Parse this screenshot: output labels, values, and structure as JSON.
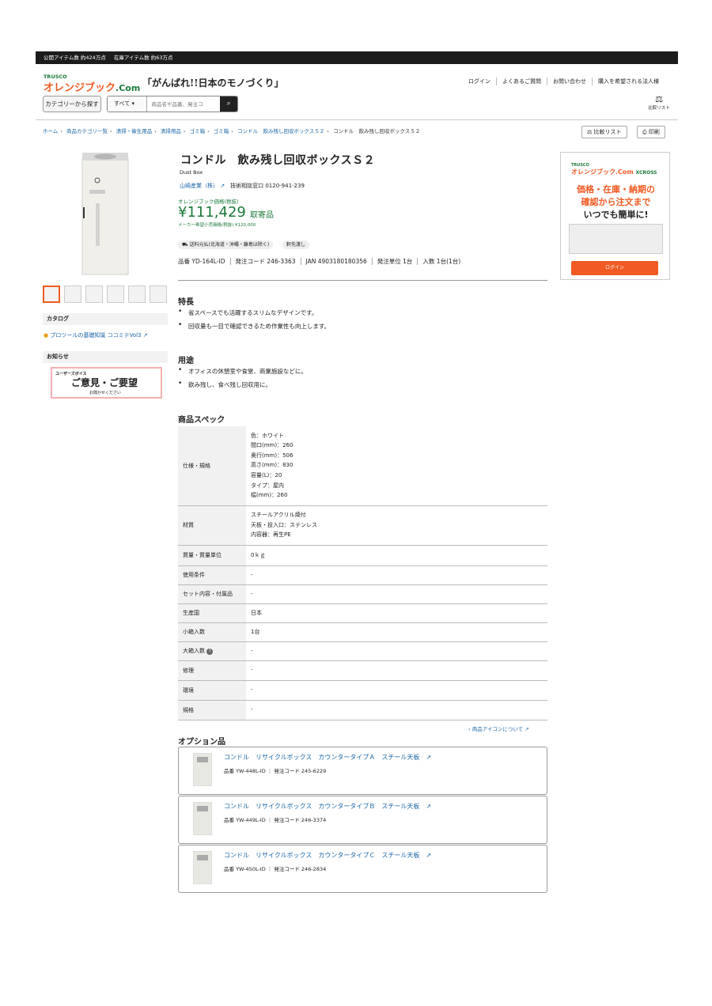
{
  "topbar": {
    "items": "公開アイテム数 約424万点",
    "stock": "在庫アイテム数 約63万点"
  },
  "logo": {
    "brand": "TRUSCO",
    "name": "オレンジブック",
    "suffix": ".Com",
    "slogan": "「がんばれ!!日本のモノづくり」"
  },
  "header_links": [
    "ログイン",
    "よくあるご質問",
    "お問い合わせ",
    "購入を希望される法人様"
  ],
  "search": {
    "category_button": "カテゴリーから探す",
    "scope": "すべて",
    "placeholder": "商品名や品番、発注コ",
    "compare_label": "比較リスト"
  },
  "breadcrumb": [
    "ホーム",
    "商品カテゴリ一覧",
    "清掃・衛生用品",
    "清掃用品",
    "ゴミ箱",
    "ゴミ箱",
    "コンドル　飲み残し回収ボックスＳ２",
    "コンドル　飲み残し回収ボックスＳ２"
  ],
  "actions": {
    "compare": "比較リスト",
    "print": "印刷"
  },
  "product": {
    "title": "コンドル　飲み残し回収ボックスＳ２",
    "subtitle": "Dust Box",
    "maker": "山崎産業（株）",
    "support": "技術相談窓口 0120-941-239",
    "price_label": "オレンジブック価格(税抜)",
    "price": "¥111,429",
    "order_type": "取寄品",
    "list_price": "メーカー希望小売価格(税抜) ¥120,000",
    "tags": [
      "送料元払(北海道・沖縄・離島は除く)",
      "軒先渡し"
    ],
    "meta": [
      "品番 YD-164L-ID",
      "発注コード 246-3363",
      "JAN 4903180180356",
      "発注単位 1台",
      "入数 1台(1台)"
    ]
  },
  "sidebar": {
    "catalog_title": "カタログ",
    "catalog_link": "プロツールの基礎知識 ココミテVol3",
    "news_title": "お知らせ",
    "voice_banner": "ご意見・ご要望",
    "voice_sub": "お聞かせください",
    "voice_label": "ユーザーズボイス"
  },
  "features": {
    "title": "特長",
    "items": [
      "省スペースでも活躍するスリムなデザインです。",
      "回収量も一目で確認できるため作業性も向上します。"
    ]
  },
  "uses": {
    "title": "用途",
    "items": [
      "オフィスの休憩室や食堂、商業施設などに。",
      "飲み残し、食べ残し回収用に。"
    ]
  },
  "spec": {
    "title": "商品スペック",
    "rows": [
      {
        "k": "仕様・規格",
        "v": [
          "色：ホワイト",
          "間口(mm)：260",
          "奥行(mm)：506",
          "高さ(mm)：830",
          "容量(L)：20",
          "タイプ：屋内",
          "幅(mm)：260"
        ]
      },
      {
        "k": "材質",
        "v": [
          "スチールアクリル焼付",
          "天板・投入口：ステンレス",
          "内容器：再生PE"
        ]
      },
      {
        "k": "質量・質量単位",
        "v": [
          "0ｋｇ"
        ]
      },
      {
        "k": "使用条件",
        "v": [
          "-"
        ]
      },
      {
        "k": "セット内容・付属品",
        "v": [
          "-"
        ]
      },
      {
        "k": "生産国",
        "v": [
          "日本"
        ]
      },
      {
        "k": "小箱入数",
        "v": [
          "1台"
        ]
      },
      {
        "k": "大箱入数",
        "v": [
          "-"
        ]
      },
      {
        "k": "修理",
        "v": [
          "-"
        ]
      },
      {
        "k": "環境",
        "v": [
          "-"
        ]
      },
      {
        "k": "規格",
        "v": [
          "-"
        ]
      }
    ]
  },
  "icon_link": "商品アイコンについて",
  "options": {
    "title": "オプション品",
    "items": [
      {
        "name": "コンドル　リサイクルボックス　カウンタータイプＡ　スチール天板",
        "code": "品番 YW-448L-ID ｜ 発注コード 245-6229"
      },
      {
        "name": "コンドル　リサイクルボックス　カウンタータイプＢ　スチール天板",
        "code": "品番 YW-449L-ID ｜ 発注コード 246-3374"
      },
      {
        "name": "コンドル　リサイクルボックス　カウンタータイプＣ　スチール天板",
        "code": "品番 YW-450L-ID ｜ 発注コード 246-2834"
      }
    ]
  },
  "banner": {
    "brand": "TRUSCO",
    "name": "オレンジブック.Com",
    "cross": "XCROSS",
    "line1": "価格・在庫・納期の",
    "line2": "確認から注文まで",
    "line3": "いつでも簡単に!",
    "login": "ログイン"
  },
  "colors": {
    "brand_orange": "#f15a22",
    "brand_green": "#1b7a3a",
    "link": "#1a66a8"
  }
}
